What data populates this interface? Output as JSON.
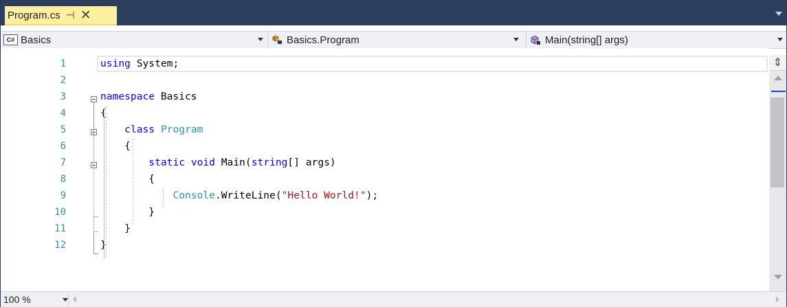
{
  "tab": {
    "title": "Program.cs",
    "pin_glyph": "⊣",
    "close_glyph": "✕"
  },
  "navbar": {
    "project": {
      "badge": "C#",
      "label": "Basics"
    },
    "type": {
      "label": "Basics.Program"
    },
    "member": {
      "label": "Main(string[] args)"
    }
  },
  "editor": {
    "line_numbers": [
      "1",
      "2",
      "3",
      "4",
      "5",
      "6",
      "7",
      "8",
      "9",
      "10",
      "11",
      "12"
    ],
    "lines": [
      [
        {
          "t": "using",
          "c": "kw"
        },
        {
          "t": " System;",
          "c": ""
        }
      ],
      [],
      [
        {
          "t": "namespace",
          "c": "kw"
        },
        {
          "t": " Basics",
          "c": ""
        }
      ],
      [
        {
          "t": "{",
          "c": ""
        }
      ],
      [
        {
          "t": "    ",
          "c": ""
        },
        {
          "t": "class",
          "c": "kw"
        },
        {
          "t": " ",
          "c": ""
        },
        {
          "t": "Program",
          "c": "ty"
        }
      ],
      [
        {
          "t": "    {",
          "c": ""
        }
      ],
      [
        {
          "t": "        ",
          "c": ""
        },
        {
          "t": "static",
          "c": "kw"
        },
        {
          "t": " ",
          "c": ""
        },
        {
          "t": "void",
          "c": "kw"
        },
        {
          "t": " Main(",
          "c": ""
        },
        {
          "t": "string",
          "c": "kw"
        },
        {
          "t": "[] args)",
          "c": ""
        }
      ],
      [
        {
          "t": "        {",
          "c": ""
        }
      ],
      [
        {
          "t": "            ",
          "c": ""
        },
        {
          "t": "Console",
          "c": "ty"
        },
        {
          "t": ".WriteLine(",
          "c": ""
        },
        {
          "t": "\"Hello World!\"",
          "c": "str"
        },
        {
          "t": ");",
          "c": ""
        }
      ],
      [
        {
          "t": "        }",
          "c": ""
        }
      ],
      [
        {
          "t": "    }",
          "c": ""
        }
      ],
      [
        {
          "t": "}",
          "c": ""
        }
      ]
    ]
  },
  "statusbar": {
    "zoom": "100 %"
  },
  "colors": {
    "keyword": "#0000ff",
    "type": "#2b91af",
    "string": "#a31515",
    "line_number": "#2b91af",
    "tab_active": "#fff0a0",
    "tabstrip": "#2d3e5f"
  },
  "icons": {
    "project": "csharp-project-icon",
    "type": "class-icon",
    "member": "method-icon",
    "pin": "pin-icon",
    "close": "close-icon"
  }
}
